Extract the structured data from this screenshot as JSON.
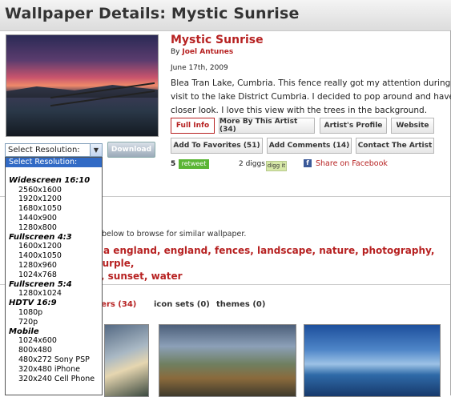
{
  "header": {
    "title": "Wallpaper Details: Mystic Sunrise"
  },
  "wallpaper": {
    "title": "Mystic Sunrise",
    "by_label": "By",
    "author": "Joel Antunes",
    "date": "June 17th, 2009",
    "description_lines": [
      "Blea Tran Lake, Cumbria. This fence really got my attention during my",
      "visit to the lake District Cumbria. I decided to pop around and have a",
      "closer look. I love this view with the trees in the background."
    ]
  },
  "buttons": {
    "full_info": "Full Info",
    "more_by_artist": "More By This Artist (34)",
    "artist_profile": "Artist's Profile",
    "website": "Website",
    "add_favorites": "Add To Favorites (51)",
    "add_comments": "Add Comments (14)",
    "contact_artist": "Contact The Artist",
    "download": "Download"
  },
  "resolution_select": {
    "value": "Select Resolution:"
  },
  "stats": {
    "tweet_count": "5",
    "retweet_label": "retweet",
    "diggs_label": "2 diggs",
    "digg_button": "digg it",
    "facebook_share": "Share on Facebook"
  },
  "similar": {
    "browse_text": "s below to browse for similar wallpaper.",
    "tag_lines": [
      "ria england, england, fences, landscape, nature, photography, purple,",
      "y, sunset, water"
    ]
  },
  "tabs": [
    {
      "label": "pers (34)",
      "active": true
    },
    {
      "label": "icon sets (0)",
      "active": false
    },
    {
      "label": "themes (0)",
      "active": false
    }
  ],
  "dropdown_options": [
    {
      "label": "Select Resolution:",
      "kind": "selected"
    },
    {
      "label": "",
      "kind": "blank"
    },
    {
      "label": "Widescreen 16:10",
      "kind": "group"
    },
    {
      "label": "2560x1600",
      "kind": "item"
    },
    {
      "label": "1920x1200",
      "kind": "item"
    },
    {
      "label": "1680x1050",
      "kind": "item"
    },
    {
      "label": "1440x900",
      "kind": "item"
    },
    {
      "label": "1280x800",
      "kind": "item"
    },
    {
      "label": "Fullscreen 4:3",
      "kind": "group"
    },
    {
      "label": "1600x1200",
      "kind": "item"
    },
    {
      "label": "1400x1050",
      "kind": "item"
    },
    {
      "label": "1280x960",
      "kind": "item"
    },
    {
      "label": "1024x768",
      "kind": "item"
    },
    {
      "label": "Fullscreen 5:4",
      "kind": "group"
    },
    {
      "label": "1280x1024",
      "kind": "item"
    },
    {
      "label": "HDTV 16:9",
      "kind": "group"
    },
    {
      "label": "1080p",
      "kind": "item"
    },
    {
      "label": "720p",
      "kind": "item"
    },
    {
      "label": "Mobile",
      "kind": "group"
    },
    {
      "label": "1024x600",
      "kind": "item"
    },
    {
      "label": "800x480",
      "kind": "item"
    },
    {
      "label": "480x272 Sony PSP",
      "kind": "item"
    },
    {
      "label": "320x480 iPhone",
      "kind": "item"
    },
    {
      "label": "320x240 Cell Phone",
      "kind": "item"
    }
  ],
  "colors": {
    "accent": "#b72222",
    "retweet_green": "#5ab534",
    "facebook_blue": "#3b5998",
    "select_highlight": "#316ac5"
  }
}
